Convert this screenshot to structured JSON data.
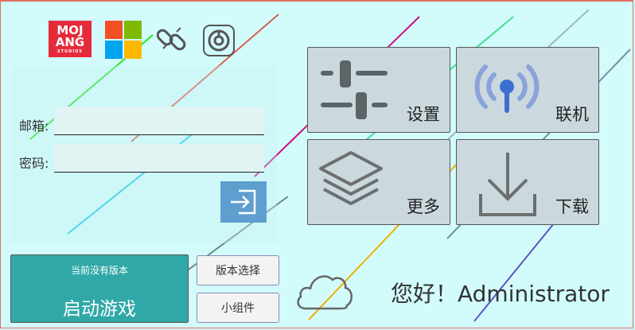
{
  "brand": {
    "mojang_line1": "MOJ",
    "mojang_line2": "ANG",
    "mojang_line3": "STUDIOS"
  },
  "login": {
    "email_label": "邮箱:",
    "email_value": "",
    "password_label": "密码:",
    "password_value": ""
  },
  "launch": {
    "version_status": "当前没有版本",
    "start_label": "启动游戏"
  },
  "buttons": {
    "version_select": "版本选择",
    "widgets": "小组件"
  },
  "tiles": {
    "settings": "设置",
    "online": "联机",
    "more": "更多",
    "download": "下载"
  },
  "greeting": "您好！Administrator",
  "colors": {
    "background": "#d2fbfc",
    "launch_button": "#31a8a8",
    "login_button": "#5f9fcf",
    "tile_background": "#cbd9de",
    "mojang_red": "#e52b3a",
    "antenna_blue": "#3c6fd0"
  },
  "icons": [
    "mojang-logo",
    "microsoft-logo",
    "chain-link-icon",
    "circle-logo-icon",
    "login-arrow-icon",
    "cloud-icon",
    "sliders-icon",
    "antenna-icon",
    "layers-icon",
    "download-icon"
  ]
}
